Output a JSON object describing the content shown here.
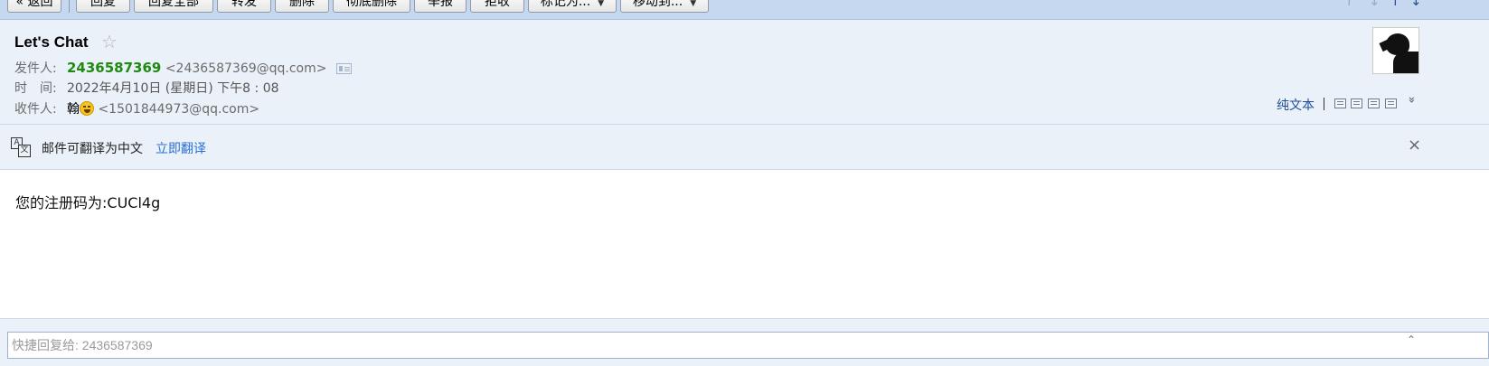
{
  "toolbar": {
    "back_label": "« 返回",
    "reply_label": "回复",
    "reply_all_label": "回复全部",
    "forward_label": "转发",
    "delete_label": "删除",
    "delete_permanent_label": "彻底删除",
    "report_label": "举报",
    "reject_label": "拒收",
    "mark_as_label": "标记为...",
    "move_to_label": "移动到...",
    "prev_icon": "up-arrow-icon",
    "next_icon": "down-arrow-icon"
  },
  "email": {
    "subject": "Let's Chat",
    "star_icon": "☆",
    "sender_label": "发件人:",
    "sender_name": "2436587369",
    "sender_email": "<2436587369@qq.com>",
    "time_label": "时　间:",
    "time_value": "2022年4月10日 (星期日) 下午8 : 08",
    "recipient_label": "收件人:",
    "recipient_name": "翰",
    "recipient_email": "<1501844973@qq.com>",
    "plaintext_label": "纯文本",
    "body_text": "您的注册码为:CUCl4g"
  },
  "translate": {
    "text": "邮件可翻译为中文",
    "link": "立即翻译",
    "close": "×",
    "icon_a": "A",
    "icon_b": "文"
  },
  "quick_reply": {
    "placeholder": "快捷回复给: 2436587369"
  },
  "colors": {
    "toolbar_bg": "#c5d8ef",
    "header_bg": "#ebf1f9",
    "sender_name": "#1f8a10",
    "link": "#2a6fd6"
  }
}
